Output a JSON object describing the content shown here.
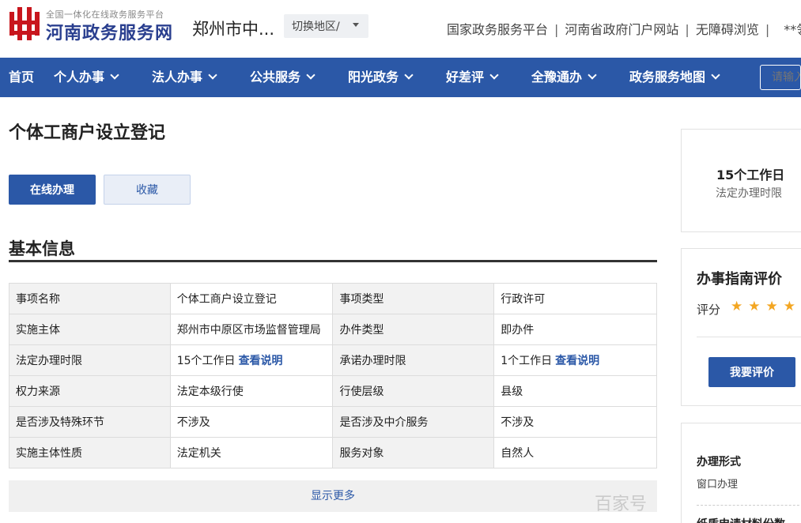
{
  "header": {
    "logo_subtitle": "全国一体化在线政务服务平台",
    "logo_title": "河南政务服务网",
    "city": "郑州市中...",
    "switch_label": "切换地区/",
    "top_links": [
      "国家政务服务平台",
      "河南省政府门户网站",
      "无障碍浏览"
    ],
    "user": "**领"
  },
  "nav": {
    "items": [
      "首页",
      "个人办事",
      "法人办事",
      "公共服务",
      "阳光政务",
      "好差评",
      "全豫通办",
      "政务服务地图"
    ],
    "search_placeholder": "请输入"
  },
  "main": {
    "title": "个体工商户设立登记",
    "btn_online": "在线办理",
    "btn_collect": "收藏",
    "section_title": "基本信息",
    "rows": [
      {
        "k1": "事项名称",
        "v1": "个体工商户设立登记",
        "k2": "事项类型",
        "v2": "行政许可"
      },
      {
        "k1": "实施主体",
        "v1": "郑州市中原区市场监督管理局",
        "k2": "办件类型",
        "v2": "即办件"
      },
      {
        "k1": "法定办理时限",
        "v1": "15个工作日",
        "k2": "承诺办理时限",
        "v2": "1个工作日"
      },
      {
        "k1": "权力来源",
        "v1": "法定本级行使",
        "k2": "行使层级",
        "v2": "县级"
      },
      {
        "k1": "是否涉及特殊环节",
        "v1": "不涉及",
        "k2": "是否涉及中介服务",
        "v2": "不涉及"
      },
      {
        "k1": "实施主体性质",
        "v1": "法定机关",
        "k2": "服务对象",
        "v2": "自然人"
      }
    ],
    "view_note": "查看说明",
    "show_more": "显示更多"
  },
  "sidebar": {
    "limit_value": "15个工作日",
    "limit_label": "法定办理时限",
    "rating_title": "办事指南评价",
    "rating_label": "评分",
    "stars": "★★★★",
    "rate_button": "我要评价",
    "form_title": "办理形式",
    "form_value": "窗口办理",
    "next_title": "纸质申请材料份数"
  },
  "watermark": "百家号",
  "colors": {
    "primary": "#2b58a7",
    "star": "#f3a622"
  }
}
